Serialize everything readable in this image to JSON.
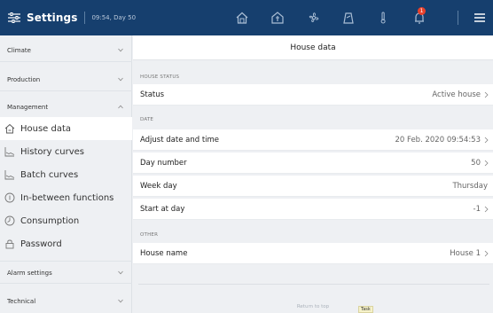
{
  "topbar": {
    "title": "Settings",
    "time": "09:54, Day 50",
    "icons": [
      "house-outline",
      "house-status",
      "fan",
      "scale",
      "thermometer",
      "bell",
      "menu"
    ],
    "alarm_count": "1"
  },
  "sidebar": {
    "sections": [
      {
        "label": "Climate",
        "state": "collapsed"
      },
      {
        "label": "Production",
        "state": "collapsed"
      },
      {
        "label": "Management",
        "state": "expanded"
      },
      {
        "label": "Alarm settings",
        "state": "collapsed"
      },
      {
        "label": "Technical",
        "state": "collapsed"
      }
    ],
    "items": [
      {
        "label": "House data",
        "icon": "house-icon",
        "active": true
      },
      {
        "label": "History curves",
        "icon": "chart-icon",
        "active": false
      },
      {
        "label": "Batch curves",
        "icon": "chart-icon",
        "active": false
      },
      {
        "label": "In-between functions",
        "icon": "info-circle-icon",
        "active": false
      },
      {
        "label": "Consumption",
        "icon": "gauge-icon",
        "active": false
      },
      {
        "label": "Password",
        "icon": "lock-icon",
        "active": false
      }
    ]
  },
  "main": {
    "title": "House data",
    "groups": [
      {
        "label": "HOUSE STATUS",
        "rows": [
          {
            "label": "Status",
            "value": "Active house"
          }
        ]
      },
      {
        "label": "DATE",
        "rows": [
          {
            "label": "Adjust date and time",
            "value": "20 Feb. 2020 09:54:53"
          },
          {
            "label": "Day number",
            "value": "50"
          },
          {
            "label": "Week day",
            "value": "Thursday"
          },
          {
            "label": "Start at day",
            "value": "-1"
          }
        ]
      },
      {
        "label": "OTHER",
        "rows": [
          {
            "label": "House name",
            "value": "House 1"
          }
        ]
      }
    ],
    "return_to_top": "Return to top",
    "tooltip": "Task"
  },
  "colors": {
    "topbar": "#163f6e",
    "alarm_badge": "#e8412c",
    "sidebar_bg": "#eef0f3",
    "active_item_bg": "#ffffff"
  }
}
